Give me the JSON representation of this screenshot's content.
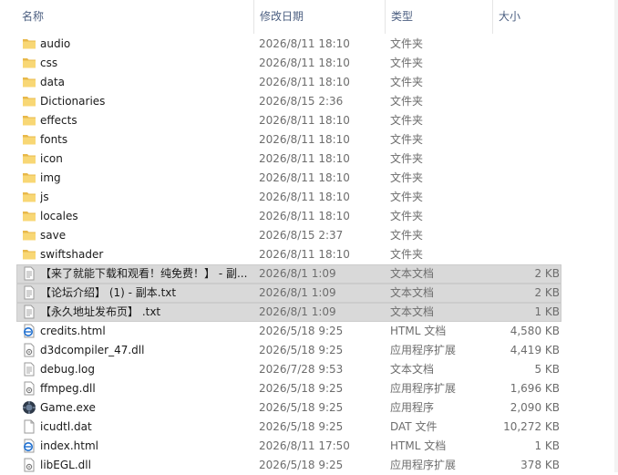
{
  "columns": {
    "name": "名称",
    "date": "修改日期",
    "type": "类型",
    "size": "大小"
  },
  "files": [
    {
      "name": "audio",
      "date": "2026/8/11 18:10",
      "type": "文件夹",
      "size": "",
      "icon": "folder-icon",
      "selected": false
    },
    {
      "name": "css",
      "date": "2026/8/11 18:10",
      "type": "文件夹",
      "size": "",
      "icon": "folder-icon",
      "selected": false
    },
    {
      "name": "data",
      "date": "2026/8/11 18:10",
      "type": "文件夹",
      "size": "",
      "icon": "folder-icon",
      "selected": false
    },
    {
      "name": "Dictionaries",
      "date": "2026/8/15 2:36",
      "type": "文件夹",
      "size": "",
      "icon": "folder-icon",
      "selected": false
    },
    {
      "name": "effects",
      "date": "2026/8/11 18:10",
      "type": "文件夹",
      "size": "",
      "icon": "folder-icon",
      "selected": false
    },
    {
      "name": "fonts",
      "date": "2026/8/11 18:10",
      "type": "文件夹",
      "size": "",
      "icon": "folder-icon",
      "selected": false
    },
    {
      "name": "icon",
      "date": "2026/8/11 18:10",
      "type": "文件夹",
      "size": "",
      "icon": "folder-icon",
      "selected": false
    },
    {
      "name": "img",
      "date": "2026/8/11 18:10",
      "type": "文件夹",
      "size": "",
      "icon": "folder-icon",
      "selected": false
    },
    {
      "name": "js",
      "date": "2026/8/11 18:10",
      "type": "文件夹",
      "size": "",
      "icon": "folder-icon",
      "selected": false
    },
    {
      "name": "locales",
      "date": "2026/8/11 18:10",
      "type": "文件夹",
      "size": "",
      "icon": "folder-icon",
      "selected": false
    },
    {
      "name": "save",
      "date": "2026/8/15 2:37",
      "type": "文件夹",
      "size": "",
      "icon": "folder-icon",
      "selected": false
    },
    {
      "name": "swiftshader",
      "date": "2026/8/11 18:10",
      "type": "文件夹",
      "size": "",
      "icon": "folder-icon",
      "selected": false
    },
    {
      "name": "【来了就能下载和观看！纯免费！】 - 副...",
      "date": "2026/8/1 1:09",
      "type": "文本文档",
      "size": "2 KB",
      "icon": "text-file-icon",
      "selected": true
    },
    {
      "name": "【论坛介绍】 (1) - 副本.txt",
      "date": "2026/8/1 1:09",
      "type": "文本文档",
      "size": "2 KB",
      "icon": "text-file-icon",
      "selected": true
    },
    {
      "name": "【永久地址发布页】 .txt",
      "date": "2026/8/1 1:09",
      "type": "文本文档",
      "size": "1 KB",
      "icon": "text-file-icon",
      "selected": true
    },
    {
      "name": "credits.html",
      "date": "2026/5/18 9:25",
      "type": "HTML 文档",
      "size": "4,580 KB",
      "icon": "html-file-icon",
      "selected": false
    },
    {
      "name": "d3dcompiler_47.dll",
      "date": "2026/5/18 9:25",
      "type": "应用程序扩展",
      "size": "4,419 KB",
      "icon": "dll-file-icon",
      "selected": false
    },
    {
      "name": "debug.log",
      "date": "2026/7/28 9:53",
      "type": "文本文档",
      "size": "5 KB",
      "icon": "text-file-icon",
      "selected": false
    },
    {
      "name": "ffmpeg.dll",
      "date": "2026/5/18 9:25",
      "type": "应用程序扩展",
      "size": "1,696 KB",
      "icon": "dll-file-icon",
      "selected": false
    },
    {
      "name": "Game.exe",
      "date": "2026/5/18 9:25",
      "type": "应用程序",
      "size": "2,090 KB",
      "icon": "exe-file-icon",
      "selected": false
    },
    {
      "name": "icudtl.dat",
      "date": "2026/5/18 9:25",
      "type": "DAT 文件",
      "size": "10,272 KB",
      "icon": "blank-file-icon",
      "selected": false
    },
    {
      "name": "index.html",
      "date": "2026/8/11 17:50",
      "type": "HTML 文档",
      "size": "1 KB",
      "icon": "html-file-icon",
      "selected": false
    },
    {
      "name": "libEGL.dll",
      "date": "2026/5/18 9:25",
      "type": "应用程序扩展",
      "size": "378 KB",
      "icon": "dll-file-icon",
      "selected": false
    }
  ]
}
